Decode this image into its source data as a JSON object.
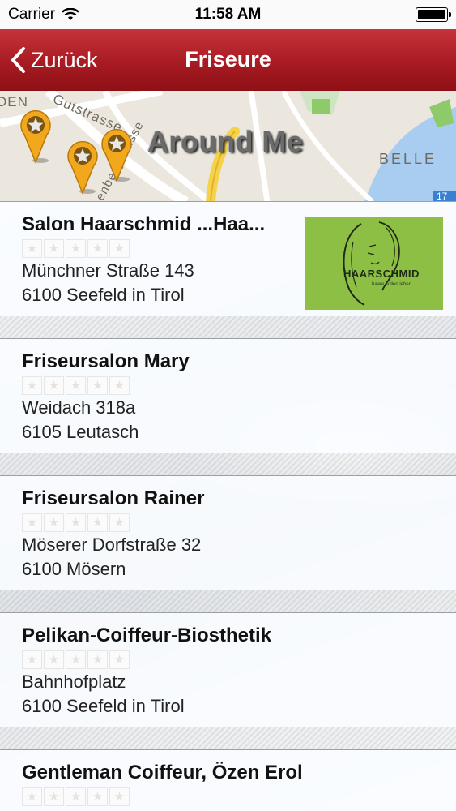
{
  "status_bar": {
    "carrier": "Carrier",
    "time": "11:58 AM"
  },
  "nav": {
    "back_label": "Zurück",
    "title": "Friseure"
  },
  "map": {
    "label": "Around Me",
    "streets": [
      "DEN",
      "Gutstrasse",
      "enbergstrasse",
      "BELLE",
      "17"
    ]
  },
  "salons": [
    {
      "name": "Salon Haarschmid ...Haa...",
      "rating": 0,
      "street": "Münchner Straße 143",
      "city": "6100 Seefeld in Tirol",
      "logo_text": "HAARSCHMID",
      "logo_subtext": "...haare sollen leben"
    },
    {
      "name": "Friseursalon Mary",
      "rating": 0,
      "street": "Weidach 318a",
      "city": "6105 Leutasch"
    },
    {
      "name": "Friseursalon Rainer",
      "rating": 0,
      "street": "Möserer Dorfstraße 32",
      "city": "6100 Mösern"
    },
    {
      "name": "Pelikan-Coiffeur-Biosthetik",
      "rating": 0,
      "street": "Bahnhofplatz",
      "city": "6100 Seefeld in Tirol"
    },
    {
      "name": "Gentleman Coiffeur, Özen Erol",
      "rating": 0,
      "street": "",
      "city": ""
    }
  ],
  "colors": {
    "nav_red": "#a81b22",
    "logo_green": "#8dbf45",
    "pin_orange": "#f2a81c"
  },
  "icons": {
    "back": "chevron-left-icon",
    "wifi": "wifi-icon",
    "battery": "battery-icon",
    "pin": "map-pin-star-icon",
    "star": "star-icon"
  }
}
